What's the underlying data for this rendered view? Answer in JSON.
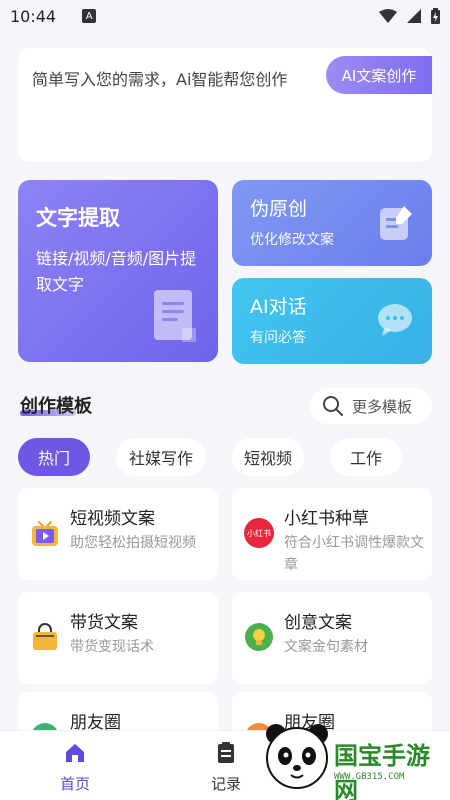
{
  "status_bar": {
    "time": "10:44",
    "badge": "A"
  },
  "prompt": {
    "placeholder": "简单写入您的需求，Ai智能帮您创作",
    "ai_button": "AI文案创作"
  },
  "feature_cards": {
    "extract": {
      "title": "文字提取",
      "subtitle": "链接/视频/音频/图片提取文字"
    },
    "original": {
      "title": "伪原创",
      "subtitle": "优化修改文案"
    },
    "dialog": {
      "title": "AI对话",
      "subtitle": "有问必答"
    }
  },
  "section": {
    "title": "创作模板",
    "more_label": "更多模板"
  },
  "tabs": [
    {
      "label": "热门",
      "active": true
    },
    {
      "label": "社媒写作",
      "active": false
    },
    {
      "label": "短视频",
      "active": false
    },
    {
      "label": "工作",
      "active": false
    }
  ],
  "templates": [
    {
      "title": "短视频文案",
      "subtitle": "助您轻松拍摄短视频",
      "icon": "tv-icon"
    },
    {
      "title": "小红书种草",
      "subtitle": "符合小红书调性爆款文章",
      "icon": "xiaohongshu-icon",
      "icon_text": "小红书"
    },
    {
      "title": "带货文案",
      "subtitle": "带货变现话术",
      "icon": "shopping-bag-icon"
    },
    {
      "title": "创意文案",
      "subtitle": "文案金句素材",
      "icon": "lightbulb-icon"
    },
    {
      "title": "朋友圈",
      "subtitle": "",
      "icon": "moments-icon"
    },
    {
      "title": "朋友圈",
      "subtitle": "",
      "icon": "camera-icon"
    }
  ],
  "bottom_nav": {
    "home": "首页",
    "records": "记录"
  },
  "watermark": {
    "text": "国宝手游网",
    "url": "WWW.GB315.COM"
  },
  "colors": {
    "accent": "#6f57e6",
    "extract_card": "#8077f2",
    "original_card": "#7490f1",
    "dialog_card": "#3fbeec"
  }
}
